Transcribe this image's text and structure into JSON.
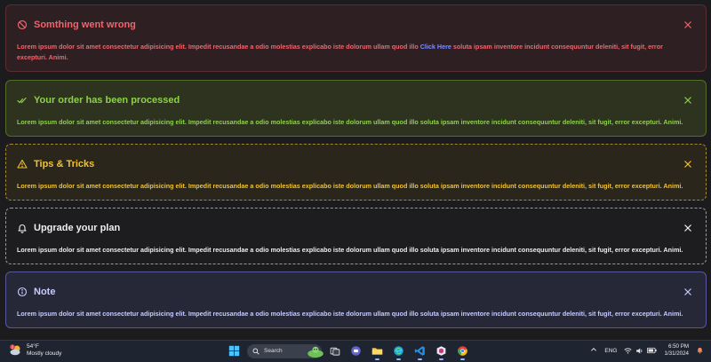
{
  "alerts": [
    {
      "variant": "danger",
      "icon": "ban-icon",
      "title": "Somthing went wrong",
      "text_before": "Lorem ipsum dolor sit amet consectetur adipisicing elit. Impedit recusandae a odio molestias explicabo iste dolorum ullam quod illo ",
      "link": "Click Here",
      "text_after": " soluta ipsam inventore incidunt consequuntur deleniti, sit fugit, error excepturi. Animi."
    },
    {
      "variant": "success",
      "icon": "check-double-icon",
      "title": "Your order has been processed",
      "text": "Lorem ipsum dolor sit amet consectetur adipisicing elit. Impedit recusandae a odio molestias explicabo iste dolorum ullam quod illo soluta ipsam inventore incidunt consequuntur deleniti, sit fugit, error excepturi. Animi."
    },
    {
      "variant": "warning",
      "icon": "warning-triangle-icon",
      "title": "Tips & Tricks",
      "text": "Lorem ipsum dolor sit amet consectetur adipisicing elit. Impedit recusandae a odio molestias explicabo iste dolorum ullam quod illo soluta ipsam inventore incidunt consequuntur deleniti, sit fugit, error excepturi. Animi."
    },
    {
      "variant": "dark",
      "icon": "bell-icon",
      "title": "Upgrade your plan",
      "text": "Lorem ipsum dolor sit amet consectetur adipisicing elit. Impedit recusandae a odio molestias explicabo iste dolorum ullam quod illo soluta ipsam inventore incidunt consequuntur deleniti, sit fugit, error excepturi. Animi."
    },
    {
      "variant": "info",
      "icon": "info-circle-icon",
      "title": "Note",
      "text": "Lorem ipsum dolor sit amet consectetur adipisicing elit. Impedit recusandae a odio molestias explicabo iste dolorum ullam quod illo soluta ipsam inventore incidunt consequuntur deleniti, sit fugit, error excepturi. Animi."
    }
  ],
  "taskbar": {
    "weather": {
      "temp": "54°F",
      "condition": "Mostly cloudy",
      "badge": "1"
    },
    "search_label": "Search",
    "language": "ENG",
    "time": "6:50 PM",
    "date": "1/31/2024"
  }
}
